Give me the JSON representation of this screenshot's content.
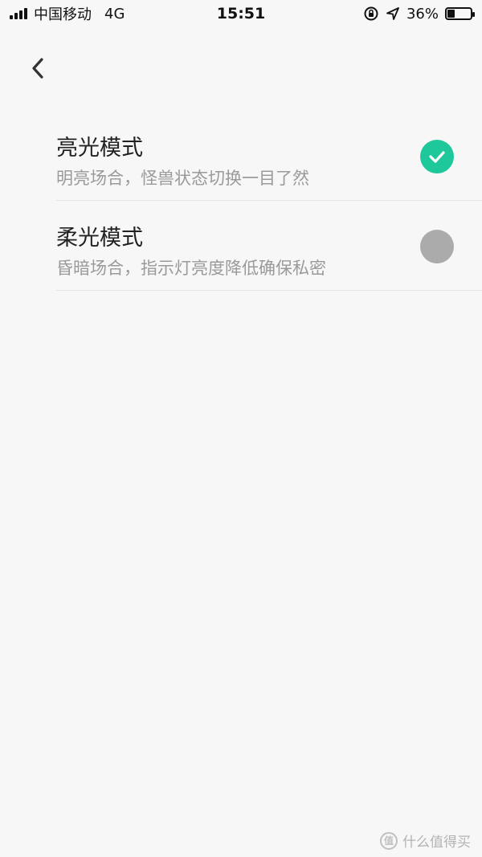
{
  "status_bar": {
    "carrier": "中国移动",
    "network": "4G",
    "time": "15:51",
    "battery_percent": "36%",
    "battery_level": 0.36
  },
  "header": {
    "back_icon": "chevron-left-icon"
  },
  "options": [
    {
      "title": "亮光模式",
      "description": "明亮场合，怪兽状态切换一目了然",
      "selected": true
    },
    {
      "title": "柔光模式",
      "description": "昏暗场合，指示灯亮度降低确保私密",
      "selected": false
    }
  ],
  "colors": {
    "accent": "#1ec89b",
    "unselected": "#ababab",
    "background": "#f7f7f7"
  },
  "watermark": {
    "text": "什么值得买",
    "logo_text": "值"
  }
}
